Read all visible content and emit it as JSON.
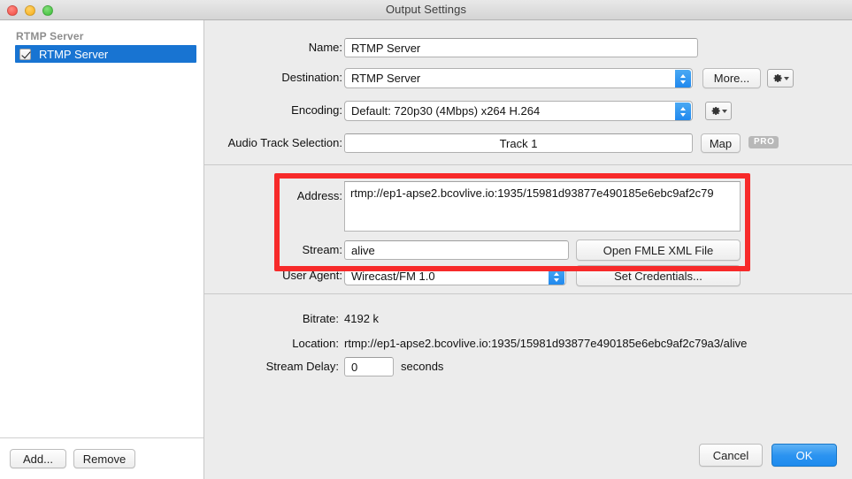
{
  "window": {
    "title": "Output Settings",
    "traffic_lights": [
      "close",
      "minimize",
      "maximize"
    ]
  },
  "sidebar": {
    "group_header": "RTMP Server",
    "items": [
      {
        "label": "RTMP Server",
        "checked": true,
        "selected": true
      }
    ],
    "footer_buttons": [
      {
        "label": "Add..."
      },
      {
        "label": "Remove"
      }
    ]
  },
  "main": {
    "fields": {
      "name": {
        "label": "Name:",
        "value": "RTMP Server"
      },
      "destination": {
        "label": "Destination:",
        "value": "RTMP Server"
      },
      "encoding": {
        "label": "Encoding:",
        "value": "Default: 720p30 (4Mbps) x264 H.264"
      },
      "audio_track": {
        "label": "Audio Track Selection:",
        "value": "Track 1"
      },
      "address": {
        "label": "Address:",
        "value": "rtmp://ep1-apse2.bcovlive.io:1935/15981d93877e490185e6ebc9af2c79"
      },
      "stream": {
        "label": "Stream:",
        "value": "alive"
      },
      "user_agent": {
        "label": "User Agent:",
        "value": "Wirecast/FM 1.0"
      },
      "stream_delay": {
        "label": "Stream Delay:",
        "value": "0",
        "unit": "seconds"
      }
    },
    "buttons": {
      "more": "More...",
      "map": "Map",
      "pro_badge": "PRO",
      "open_fmle": "Open FMLE XML File",
      "set_credentials": "Set Credentials..."
    },
    "info": {
      "bitrate_label": "Bitrate:",
      "bitrate_value": "4192 k",
      "location_label": "Location:",
      "location_value": "rtmp://ep1-apse2.bcovlive.io:1935/15981d93877e490185e6ebc9af2c79a3/alive"
    },
    "highlight_color": "#f72a2a"
  },
  "actions": {
    "cancel": "Cancel",
    "ok": "OK"
  },
  "colors": {
    "accent_blue": "#1e8bee",
    "selection_blue": "#1874d2",
    "window_bg": "#ececec",
    "highlight_red": "#f72a2a"
  }
}
